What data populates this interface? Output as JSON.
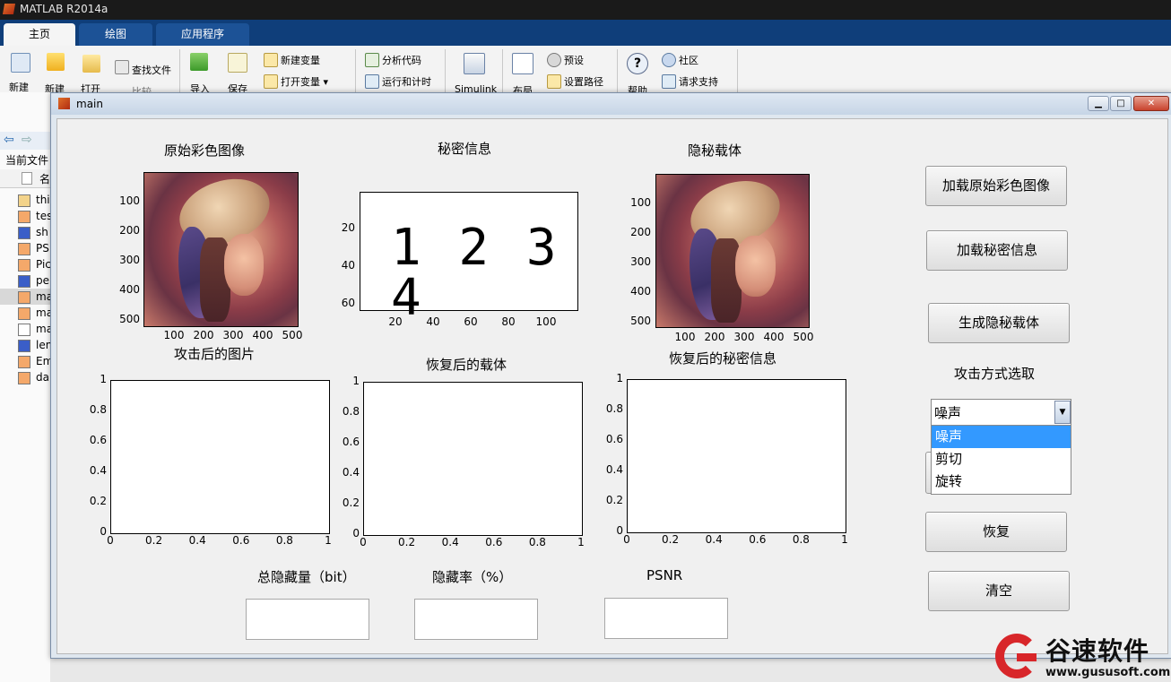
{
  "matlab": {
    "title": "MATLAB R2014a",
    "tabs": [
      "主页",
      "绘图",
      "应用程序"
    ],
    "ribbon": {
      "new_script": "新建\n脚本",
      "new": "新建",
      "open": "打开",
      "find_files": "查找文件",
      "compare": "比较",
      "import": "导入",
      "save": "保存",
      "new_variable": "新建变量",
      "open_variable": "打开变量",
      "analyze_code": "分析代码",
      "run_and_time": "运行和计时",
      "simulink": "Simulink",
      "layout": "布局",
      "preferences": "预设",
      "set_path": "设置路径",
      "help": "帮助",
      "community": "社区",
      "request_support": "请求支持"
    },
    "current_folder_label": "当前文件",
    "name_header": "名",
    "files": [
      {
        "name": "thi",
        "type": "fig"
      },
      {
        "name": "tes",
        "type": "m"
      },
      {
        "name": "sh",
        "type": "bmp"
      },
      {
        "name": "PS",
        "type": "m"
      },
      {
        "name": "Pic",
        "type": "m"
      },
      {
        "name": "pe",
        "type": "bmp"
      },
      {
        "name": "ma",
        "type": "m"
      },
      {
        "name": "ma",
        "type": "m"
      },
      {
        "name": "ma",
        "type": "txt"
      },
      {
        "name": "len",
        "type": "bmp"
      },
      {
        "name": "Em",
        "type": "m"
      },
      {
        "name": "da",
        "type": "m"
      }
    ]
  },
  "figure": {
    "title": "main",
    "panels": {
      "original": "原始彩色图像",
      "secret": "秘密信息",
      "stego": "隐秘载体",
      "attacked": "攻击后的图片",
      "recovered_carrier": "恢复后的载体",
      "recovered_secret": "恢复后的秘密信息"
    },
    "secret_text": "1 2 3 4",
    "img_y_ticks": [
      "100",
      "200",
      "300",
      "400",
      "500"
    ],
    "img_x_ticks": [
      "100",
      "200",
      "300",
      "400",
      "500"
    ],
    "secret_y_ticks": [
      "20",
      "40",
      "60"
    ],
    "secret_x_ticks": [
      "20",
      "40",
      "60",
      "80",
      "100"
    ],
    "empty_ticks": [
      "0",
      "0.2",
      "0.4",
      "0.6",
      "0.8",
      "1"
    ],
    "buttons": {
      "load_original": "加载原始彩色图像",
      "load_secret": "加载秘密信息",
      "generate": "生成隐秘载体",
      "recover": "恢复",
      "clear": "清空"
    },
    "attack_label": "攻击方式选取",
    "attack_selected": "噪声",
    "attack_options": [
      "噪声",
      "剪切",
      "旋转"
    ],
    "metrics": {
      "total_label": "总隐藏量（bit）",
      "rate_label": "隐藏率（%）",
      "psnr_label": "PSNR",
      "total_value": "",
      "rate_value": "",
      "psnr_value": ""
    }
  },
  "watermark": {
    "brand": "谷速软件",
    "url": "www.gususoft.com"
  }
}
